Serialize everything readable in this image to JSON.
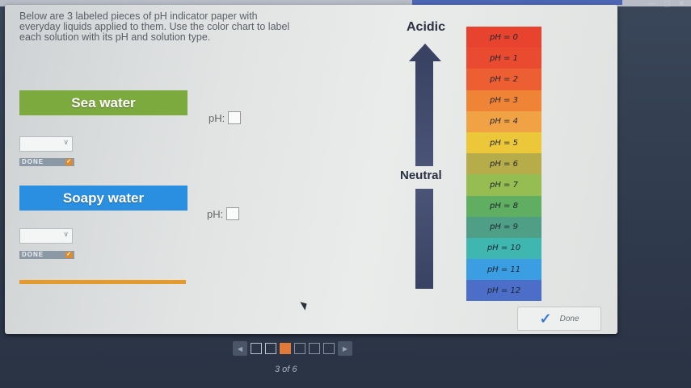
{
  "instructions": "Below are 3 labeled pieces of pH indicator paper with everyday liquids applied to them. Use the color chart to label each solution with its pH and solution type.",
  "samples": [
    {
      "label": "Sea water",
      "ph_label": "pH:",
      "done_label": "DONE"
    },
    {
      "label": "Soapy water",
      "ph_label": "pH:",
      "done_label": "DONE"
    }
  ],
  "scale": {
    "acidic_label": "Acidic",
    "neutral_label": "Neutral",
    "levels": [
      {
        "label": "pH = 0",
        "color": "#e8432e"
      },
      {
        "label": "pH = 1",
        "color": "#ea4a30"
      },
      {
        "label": "pH = 2",
        "color": "#ed5f33"
      },
      {
        "label": "pH = 3",
        "color": "#ef8436"
      },
      {
        "label": "pH = 4",
        "color": "#f0a244"
      },
      {
        "label": "pH = 5",
        "color": "#ecc73a"
      },
      {
        "label": "pH = 6",
        "color": "#b6ac49"
      },
      {
        "label": "pH = 7",
        "color": "#96bd52"
      },
      {
        "label": "pH = 8",
        "color": "#5fae62"
      },
      {
        "label": "pH = 9",
        "color": "#4f9f86"
      },
      {
        "label": "pH = 10",
        "color": "#3fb6b0"
      },
      {
        "label": "pH = 11",
        "color": "#3b9ee3"
      },
      {
        "label": "pH = 12",
        "color": "#4c6ec8"
      }
    ]
  },
  "done_button": {
    "label": "Done",
    "icon": "check-icon"
  },
  "pager": {
    "prev_icon": "chevron-left-icon",
    "next_icon": "chevron-right-icon",
    "current": 3,
    "total": 6
  },
  "page_count_text": "3 of 6"
}
